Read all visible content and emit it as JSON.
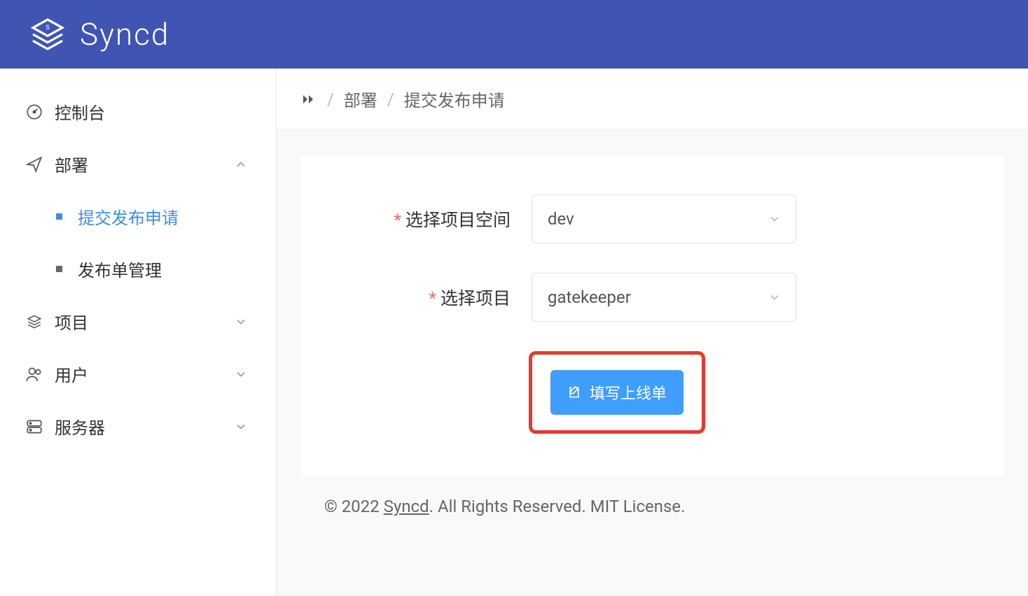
{
  "header": {
    "app_name": "Syncd"
  },
  "sidebar": {
    "items": [
      {
        "label": "控制台"
      },
      {
        "label": "部署",
        "expanded": true,
        "children": [
          {
            "label": "提交发布申请",
            "active": true
          },
          {
            "label": "发布单管理"
          }
        ]
      },
      {
        "label": "项目"
      },
      {
        "label": "用户"
      },
      {
        "label": "服务器"
      }
    ]
  },
  "breadcrumb": {
    "level1": "部署",
    "level2": "提交发布申请"
  },
  "form": {
    "space_label": "选择项目空间",
    "space_value": "dev",
    "project_label": "选择项目",
    "project_value": "gatekeeper",
    "submit_label": "填写上线单"
  },
  "footer": {
    "prefix": "© 2022 ",
    "link": "Syncd",
    "suffix": ". All Rights Reserved. MIT License."
  }
}
